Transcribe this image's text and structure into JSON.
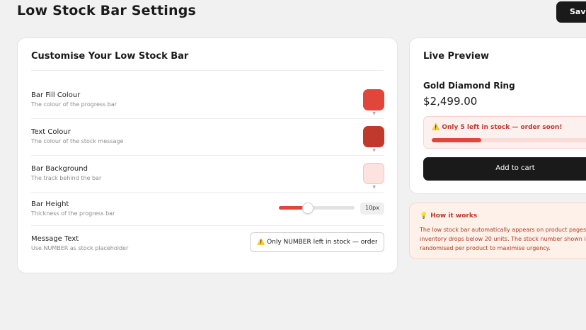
{
  "header": {
    "title": "Low Stock Bar Settings",
    "save_label": "Save"
  },
  "settings": {
    "title": "Customise Your Low Stock Bar",
    "bar_fill": {
      "label": "Bar Fill Colour",
      "desc": "The colour of the progress bar",
      "color": "#e0463b"
    },
    "text_colour": {
      "label": "Text Colour",
      "desc": "The colour of the stock message",
      "color": "#c0392b"
    },
    "bar_background": {
      "label": "Bar Background",
      "desc": "The track behind the bar",
      "color": "#fde2e0"
    },
    "bar_height": {
      "label": "Bar Height",
      "desc": "Thickness of the progress bar",
      "value_label": "10px",
      "slider_fraction": 0.38
    },
    "message_text": {
      "label": "Message Text",
      "desc": "Use NUMBER as stock placeholder",
      "value": "⚠️ Only NUMBER left in stock — order soon!"
    }
  },
  "preview": {
    "title": "Live Preview",
    "product_name": "Gold Diamond Ring",
    "product_price": "$2,499.00",
    "stock_message": "⚠️ Only 5 left in stock — order soon!",
    "stock_fraction": 0.28,
    "add_to_cart_label": "Add to cart"
  },
  "how_it_works": {
    "icon": "lightbulb-icon",
    "title": "How it works",
    "lines": [
      "The low stock bar automatically appears on product pages",
      "inventory drops below 20 units. The stock number shown i",
      "randomised per product to maximise urgency."
    ]
  }
}
